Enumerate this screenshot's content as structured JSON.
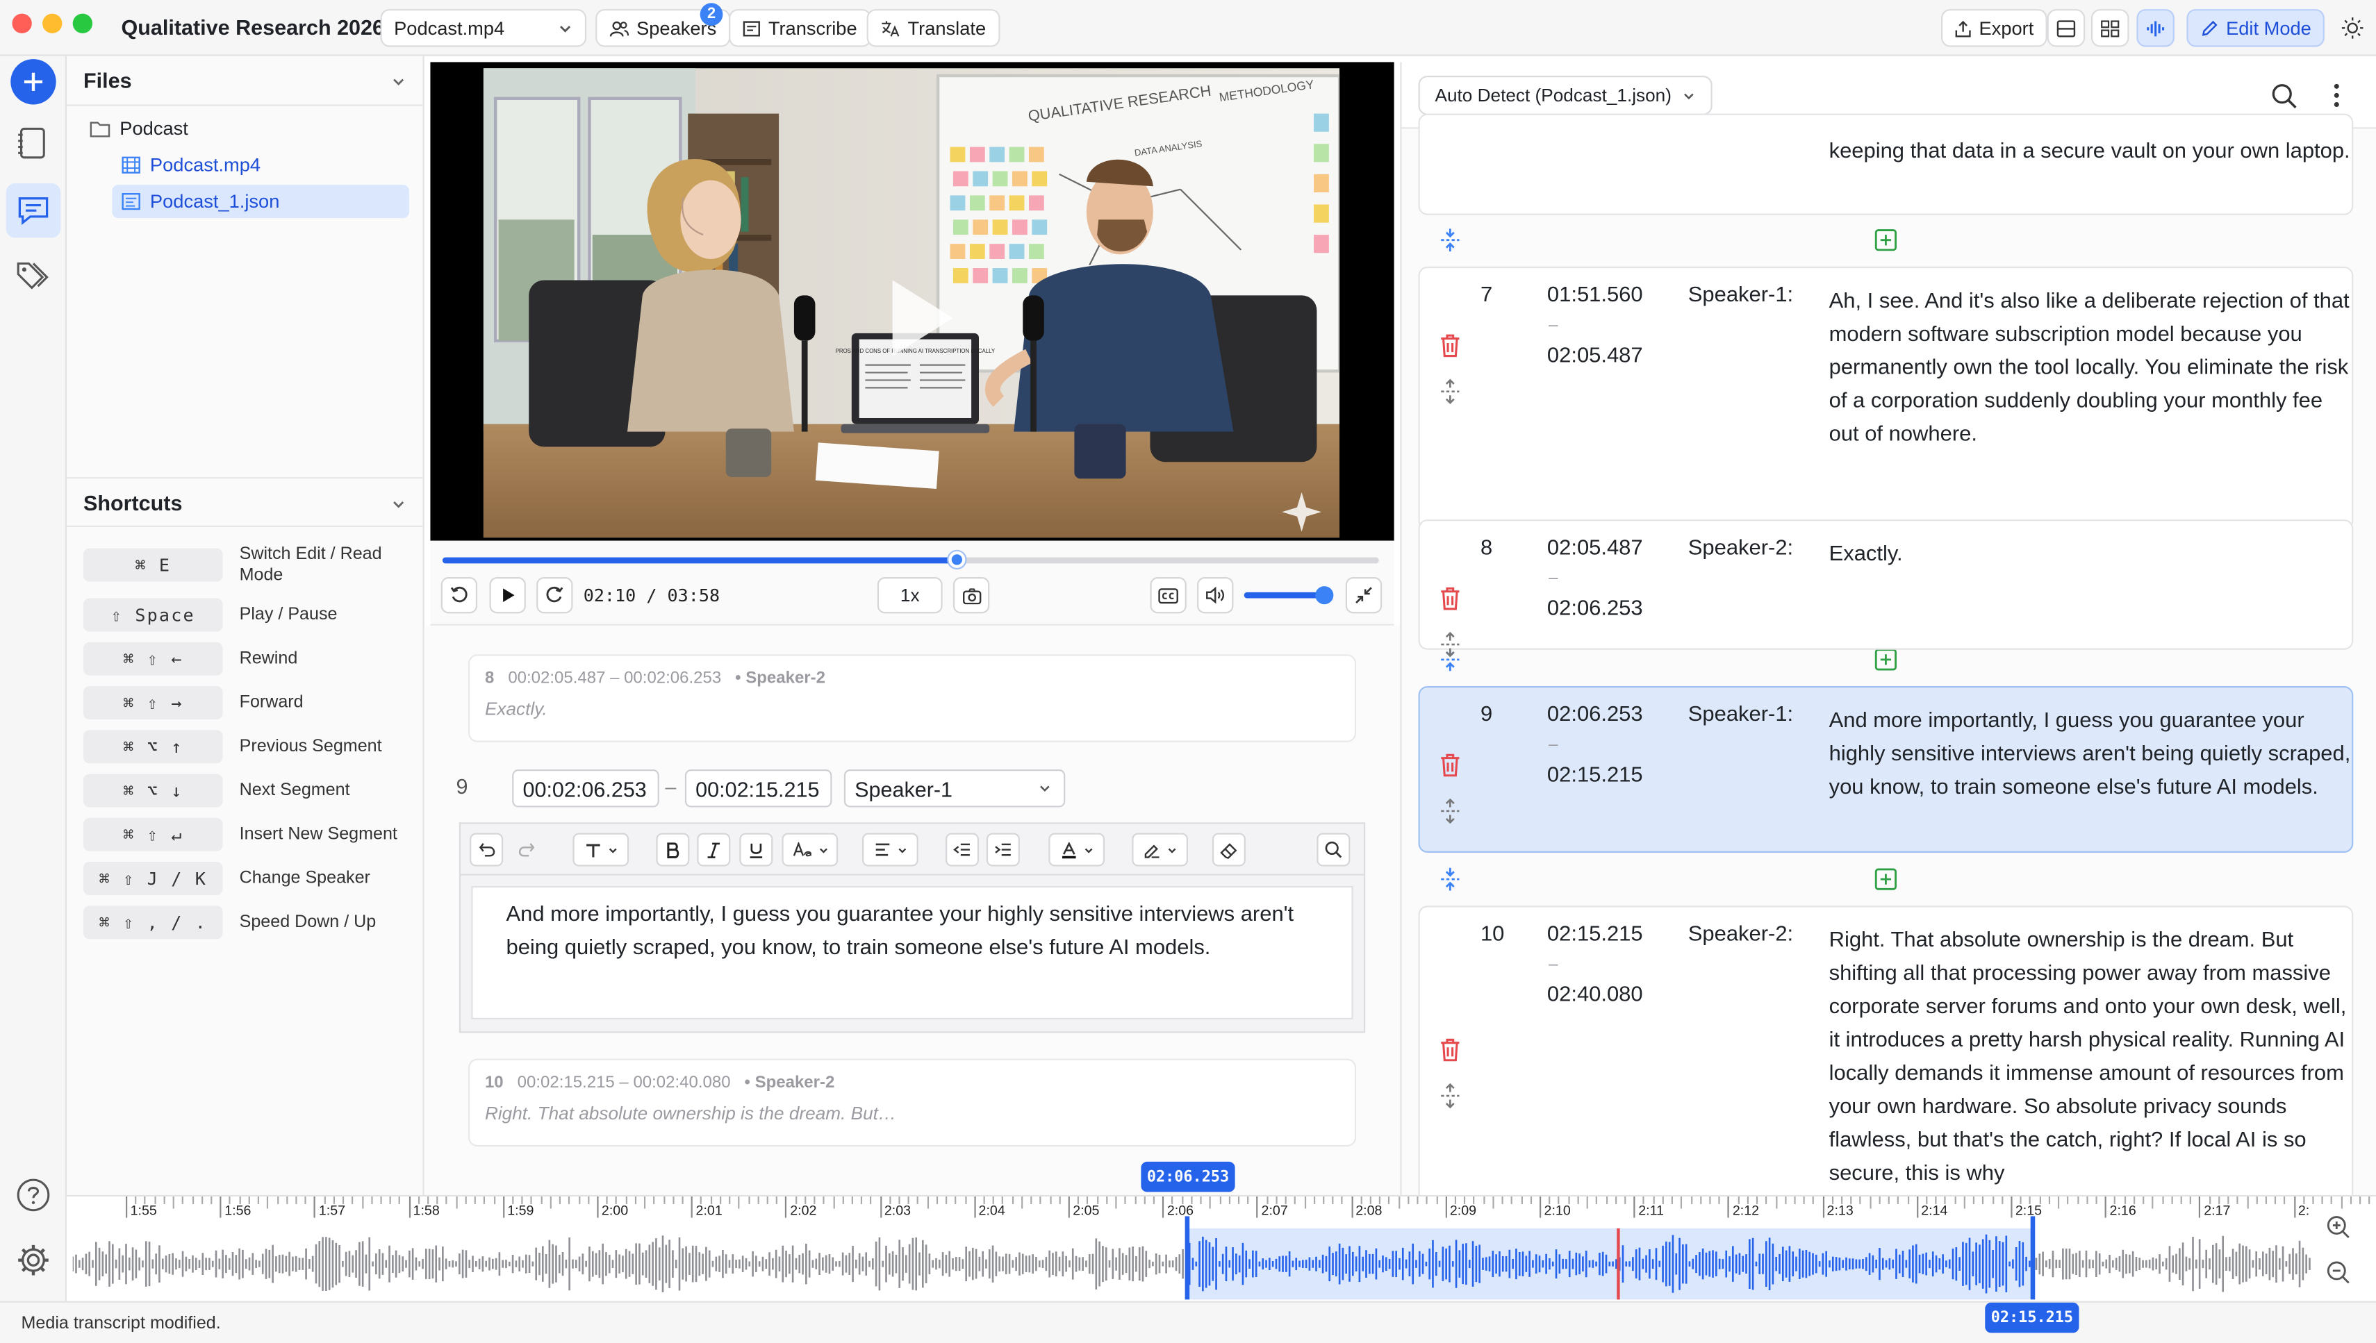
{
  "app": {
    "title": "Qualitative Research 2026",
    "media_select": "Podcast.mp4",
    "speakers_label": "Speakers",
    "speakers_badge": "2",
    "transcribe_label": "Transcribe",
    "translate_label": "Translate",
    "export_label": "Export",
    "edit_mode_label": "Edit Mode"
  },
  "files": {
    "title": "Files",
    "folder": "Podcast",
    "items": [
      "Podcast.mp4",
      "Podcast_1.json"
    ]
  },
  "shortcuts": {
    "title": "Shortcuts",
    "items": [
      {
        "keys": "⌘ E",
        "label": "Switch Edit / Read Mode"
      },
      {
        "keys": "⇧ Space",
        "label": "Play / Pause"
      },
      {
        "keys": "⌘ ⇧ ←",
        "label": "Rewind"
      },
      {
        "keys": "⌘ ⇧ →",
        "label": "Forward"
      },
      {
        "keys": "⌘ ⌥ ↑",
        "label": "Previous Segment"
      },
      {
        "keys": "⌘ ⌥ ↓",
        "label": "Next Segment"
      },
      {
        "keys": "⌘ ⇧ ↵",
        "label": "Insert New Segment"
      },
      {
        "keys": "⌘ ⇧ J / K",
        "label": "Change Speaker"
      },
      {
        "keys": "⌘ ⇧ , / .",
        "label": "Speed Down / Up"
      }
    ]
  },
  "video": {
    "whiteboard_title": "QUALITATIVE RESEARCH",
    "whiteboard_methodology": "METHODOLOGY",
    "whiteboard_data": "DATA ANALYSIS",
    "laptop_title": "PROS AND CONS OF RUNNING AI TRANSCRIPTION LOCALLY",
    "time_display": "02:10 / 03:58",
    "speed": "1x",
    "progress": 0.55,
    "volume": 0.9
  },
  "editor": {
    "prev_segment": {
      "num": "8",
      "range": "00:02:05.487 – 00:02:06.253",
      "speaker": "• Speaker-2",
      "text": "Exactly."
    },
    "current": {
      "num": "9",
      "start": "00:02:06.253",
      "end": "00:02:15.215",
      "speaker": "Speaker-1",
      "text": "And more importantly, I guess you guarantee your highly sensitive interviews aren't being quietly scraped, you know, to train someone else's future AI models."
    },
    "next_segment": {
      "num": "10",
      "range": "00:02:15.215 – 00:02:40.080",
      "speaker": "• Speaker-2",
      "text": "Right. That absolute ownership is the dream. But…"
    }
  },
  "transcript": {
    "source_select": "Auto Detect (Podcast_1.json)",
    "top_text": "keeping that data in a secure vault on your own laptop.",
    "rows": [
      {
        "num": "7",
        "start": "01:51.560",
        "end": "02:05.487",
        "speaker": "Speaker-1:",
        "text": "Ah, I see. And it's also like a deliberate rejection of that modern software subscription model because you permanently own the tool locally. You eliminate the risk of a corporation suddenly doubling your monthly fee out of nowhere."
      },
      {
        "num": "8",
        "start": "02:05.487",
        "end": "02:06.253",
        "speaker": "Speaker-2:",
        "text": "Exactly."
      },
      {
        "num": "9",
        "start": "02:06.253",
        "end": "02:15.215",
        "speaker": "Speaker-1:",
        "text": "And more importantly, I guess you guarantee your highly sensitive interviews aren't being quietly scraped, you know, to train someone else's future AI models."
      },
      {
        "num": "10",
        "start": "02:15.215",
        "end": "02:40.080",
        "speaker": "Speaker-2:",
        "text": "Right. That absolute ownership is the dream. But shifting all that processing power away from massive corporate server forums and onto your own desk, well, it introduces a pretty harsh physical reality. Running AI locally demands it immense amount of resources from your own hardware. So absolute privacy sounds flawless, but that's the catch, right? If local AI is so secure, this is why"
      }
    ],
    "dash": "–"
  },
  "timeline": {
    "ticks": [
      "1:55",
      "1:56",
      "1:57",
      "1:58",
      "1:59",
      "2:00",
      "2:01",
      "2:02",
      "2:03",
      "2:04",
      "2:05",
      "2:06",
      "2:07",
      "2:08",
      "2:09",
      "2:10",
      "2:11",
      "2:12",
      "2:13",
      "2:14",
      "2:15",
      "2:16",
      "2:17",
      "2:"
    ],
    "sel_start": "02:06.253",
    "sel_end": "02:15.215"
  },
  "status": "Media transcript modified.",
  "colors": {
    "accent": "#2563eb",
    "danger": "#e5484d",
    "green": "#2ea043"
  }
}
